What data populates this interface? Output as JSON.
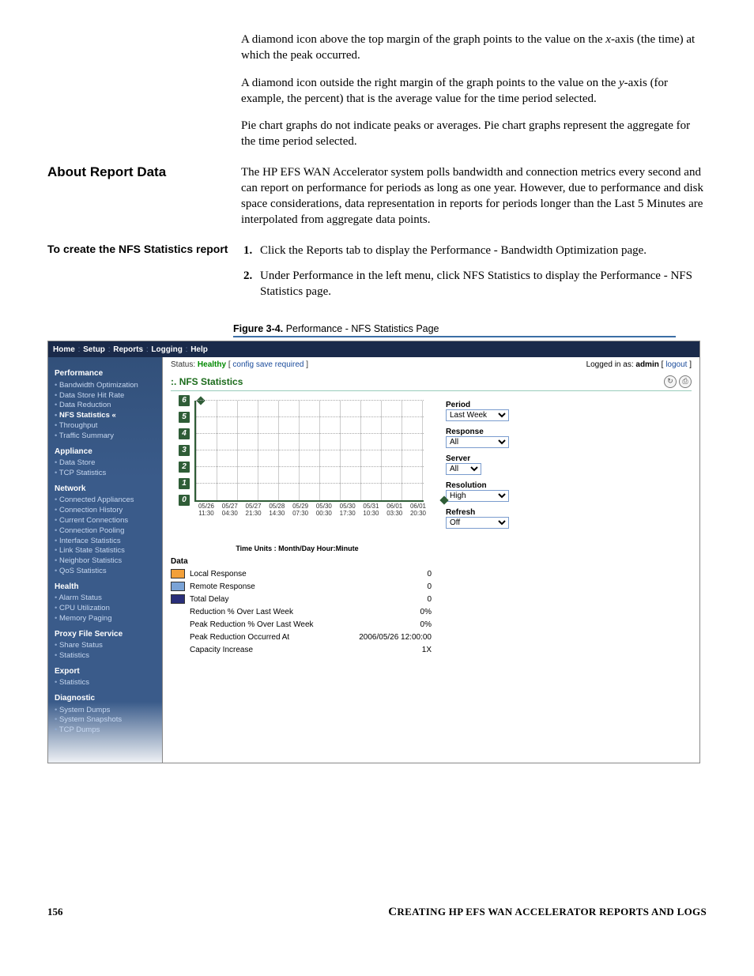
{
  "paragraphs": {
    "p1a": "A diamond icon above the top margin of the graph points to the value on the ",
    "p1b": "x",
    "p1c": "-axis (the time) at which the peak occurred.",
    "p2a": "A diamond icon outside the right margin of the graph points to the value on the ",
    "p2b": "y",
    "p2c": "-axis (for example, the percent) that is the average value for the time period selected.",
    "p3": "Pie chart graphs do not indicate peaks or averages. Pie chart graphs represent the aggregate for the time period selected."
  },
  "about": {
    "heading": "About Report Data",
    "body": "The HP EFS WAN Accelerator system polls bandwidth and connection metrics every second and can report on performance for periods as long as one year. However, due to performance and disk space considerations, data representation in reports for periods longer than the Last 5 Minutes are interpolated from aggregate data points."
  },
  "create": {
    "heading": "To create the NFS Statistics report",
    "step1": "Click the Reports tab to display the Performance - Bandwidth Optimization page.",
    "step2": "Under Performance in the left menu, click NFS Statistics to display the Performance - NFS Statistics page."
  },
  "figcap": {
    "bold": "Figure 3-4.",
    "rest": " Performance - NFS Statistics Page"
  },
  "topnav": [
    "Home",
    "Setup",
    "Reports",
    "Logging",
    "Help"
  ],
  "status": {
    "label": "Status:",
    "value": "Healthy",
    "link": "config save required"
  },
  "logged": {
    "prefix": "Logged in as: ",
    "user": "admin",
    "logout": "logout"
  },
  "sidebar": {
    "groups": [
      {
        "title": "Performance",
        "items": [
          "Bandwidth Optimization",
          "Data Store Hit Rate",
          "Data Reduction",
          "NFS Statistics «",
          "Throughput",
          "Traffic Summary"
        ],
        "active": 3
      },
      {
        "title": "Appliance",
        "items": [
          "Data Store",
          "TCP Statistics"
        ]
      },
      {
        "title": "Network",
        "items": [
          "Connected Appliances",
          "Connection History",
          "Current Connections",
          "Connection Pooling",
          "Interface Statistics",
          "Link State Statistics",
          "Neighbor Statistics",
          "QoS Statistics"
        ]
      },
      {
        "title": "Health",
        "items": [
          "Alarm Status",
          "CPU Utilization",
          "Memory Paging"
        ]
      },
      {
        "title": "Proxy File Service",
        "items": [
          "Share Status",
          "Statistics"
        ]
      },
      {
        "title": "Export",
        "items": [
          "Statistics"
        ]
      },
      {
        "title": "Diagnostic",
        "items": [
          "System Dumps",
          "System Snapshots",
          "TCP Dumps"
        ]
      }
    ]
  },
  "page_title": "NFS Statistics",
  "controls": {
    "Period": "Last Week",
    "Response": "All",
    "Server": "All",
    "Resolution": "High",
    "Refresh": "Off"
  },
  "chart_data": {
    "type": "line",
    "title": "",
    "xlabel": "Time Units :  Month/Day Hour:Minute",
    "ylabel": "",
    "ylim": [
      0,
      6
    ],
    "y_ticks": [
      0,
      1,
      2,
      3,
      4,
      5,
      6
    ],
    "categories": [
      "05/26",
      "05/27",
      "05/27",
      "05/28",
      "05/29",
      "05/30",
      "05/30",
      "05/31",
      "06/01",
      "06/01"
    ],
    "categories_sub": [
      "11:30",
      "04:30",
      "21:30",
      "14:30",
      "07:30",
      "00:30",
      "17:30",
      "10:30",
      "03:30",
      "20:30"
    ],
    "series": [
      {
        "name": "Local Response",
        "values": [
          0,
          0,
          0,
          0,
          0,
          0,
          0,
          0,
          0,
          0
        ]
      },
      {
        "name": "Remote Response",
        "values": [
          0,
          0,
          0,
          0,
          0,
          0,
          0,
          0,
          0,
          0
        ]
      },
      {
        "name": "Total Delay",
        "values": [
          0,
          0,
          0,
          0,
          0,
          0,
          0,
          0,
          0,
          0
        ]
      }
    ],
    "peak_marker_x_index": 0
  },
  "data_table": {
    "heading": "Data",
    "rows": [
      {
        "color": "#f2a03a",
        "label": "Local Response",
        "value": "0"
      },
      {
        "color": "#7aa3d6",
        "label": "Remote Response",
        "value": "0"
      },
      {
        "color": "#2a2f7a",
        "label": "Total Delay",
        "value": "0"
      },
      {
        "color": null,
        "label": "Reduction % Over Last Week",
        "value": "0%"
      },
      {
        "color": null,
        "label": "Peak Reduction % Over Last Week",
        "value": "0%"
      },
      {
        "color": null,
        "label": "Peak Reduction Occurred At",
        "value": "2006/05/26 12:00:00"
      },
      {
        "color": null,
        "label": "Capacity Increase",
        "value": "1X"
      }
    ]
  },
  "footer": {
    "page": "156",
    "title_a": "C",
    "title_rest": "REATING HP EFS WAN ACCELERATOR REPORTS AND LOGS"
  }
}
